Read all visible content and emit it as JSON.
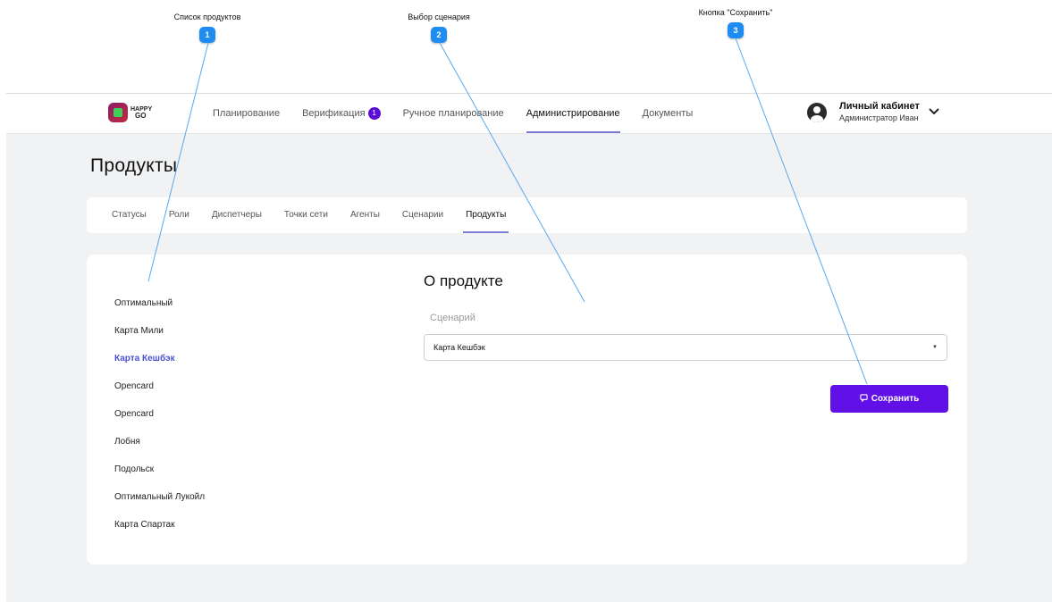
{
  "callouts": [
    {
      "title": "Список продуктов",
      "number": "1"
    },
    {
      "title": "Выбор сценария",
      "number": "2"
    },
    {
      "title": "Кнопка \"Сохранить\"",
      "number": "3"
    }
  ],
  "header": {
    "logo_text_top": "HAPPY",
    "logo_text_bottom": "GO",
    "nav": [
      {
        "label": "Планирование"
      },
      {
        "label": "Верификация",
        "badge": "1"
      },
      {
        "label": "Ручное планирование"
      },
      {
        "label": "Администрирование",
        "active": true
      },
      {
        "label": "Документы"
      }
    ],
    "account": {
      "title": "Личный кабинет",
      "subtitle": "Администратор Иван",
      "avatar_icon": "user-circle-icon",
      "chevron_icon": "chevron-down-icon"
    }
  },
  "page": {
    "title": "Продукты",
    "subtabs": [
      "Статусы",
      "Роли",
      "Диспетчеры",
      "Точки сети",
      "Агенты",
      "Сценарии",
      "Продукты"
    ],
    "active_subtab": "Продукты"
  },
  "products": {
    "items": [
      "Оптимальный",
      "Карта Мили",
      "Карта Кешбэк",
      "Opencard",
      "Opencard",
      "Лобня",
      "Подольск",
      "Оптимальный Лукойл",
      "Карта Спартак"
    ],
    "selected": "Карта Кешбэк"
  },
  "detail": {
    "title": "О продукте",
    "scenario_label": "Сценарий",
    "scenario_value": "Карта Кешбэк",
    "save_label": "Сохранить",
    "save_icon": "message-square-icon"
  },
  "colors": {
    "accent": "#6111e8",
    "active_underline": "#7b7bd8",
    "selected_item": "#4a52d4",
    "callout_badge": "#1e8cf0",
    "page_bg": "#f1f2f4"
  }
}
